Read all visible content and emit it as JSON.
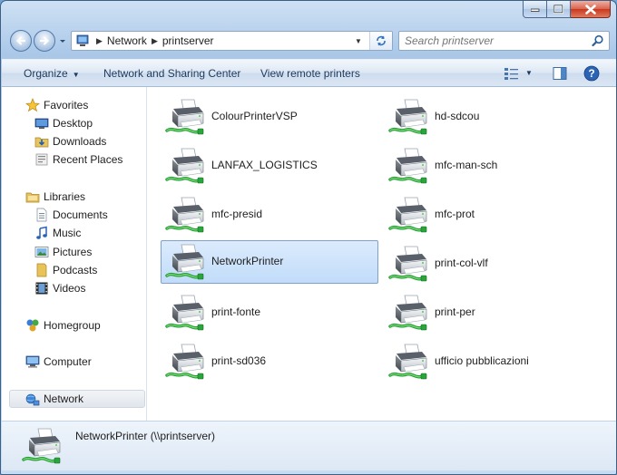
{
  "address": {
    "crumbs": [
      "Network",
      "printserver"
    ]
  },
  "search": {
    "placeholder": "Search printserver"
  },
  "toolbar": {
    "organize": "Organize",
    "network_sharing": "Network and Sharing Center",
    "view_remote": "View remote printers"
  },
  "nav": {
    "favorites": "Favorites",
    "desktop": "Desktop",
    "downloads": "Downloads",
    "recent": "Recent Places",
    "libraries": "Libraries",
    "documents": "Documents",
    "music": "Music",
    "pictures": "Pictures",
    "podcasts": "Podcasts",
    "videos": "Videos",
    "homegroup": "Homegroup",
    "computer": "Computer",
    "network": "Network"
  },
  "printers": [
    "ColourPrinterVSP",
    "hd-sdcou",
    "LANFAX_LOGISTICS",
    "mfc-man-sch",
    "mfc-presid",
    "mfc-prot",
    "NetworkPrinter",
    "print-col-vlf",
    "print-fonte",
    "print-per",
    "print-sd036",
    "ufficio pubblicazioni"
  ],
  "selected_printer": "NetworkPrinter",
  "details": {
    "label": "NetworkPrinter (\\\\printserver)"
  },
  "colors": {
    "selection": "#cce4fb",
    "selection_border": "#7da2ce",
    "toolbar_text": "#1e395b"
  }
}
